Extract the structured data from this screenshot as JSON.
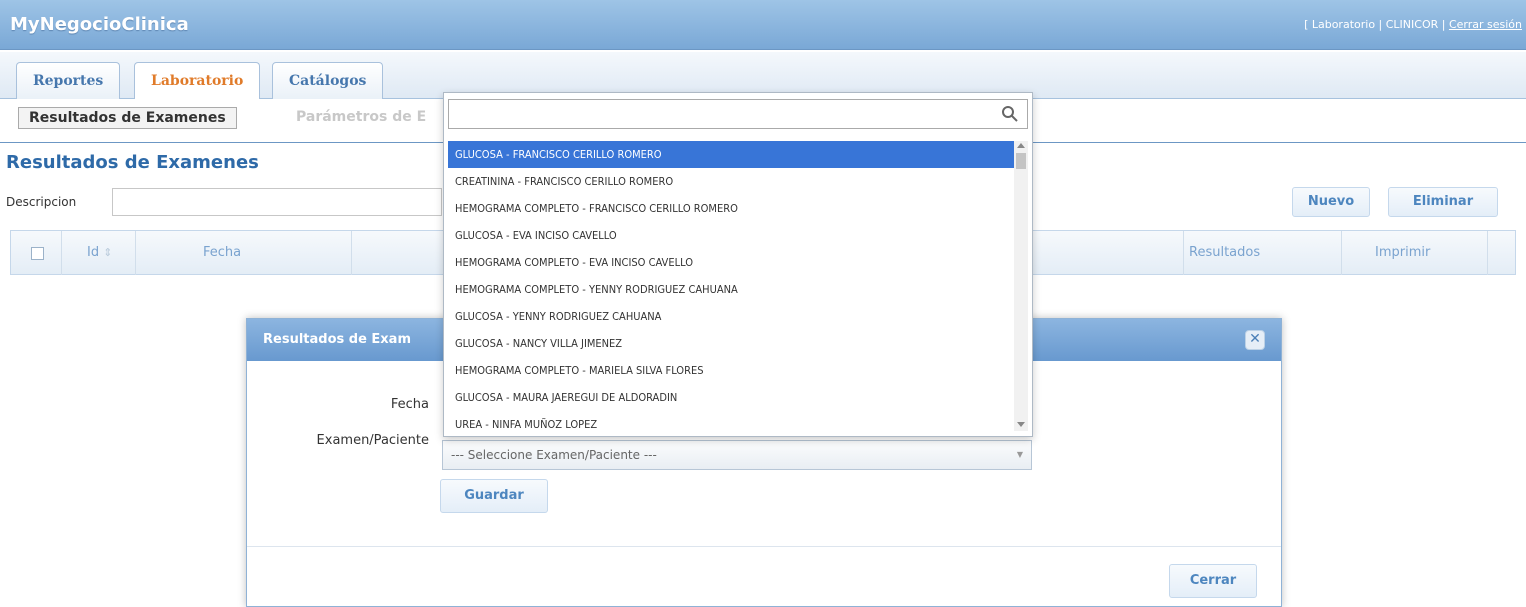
{
  "app": {
    "title": "MyNegocioClinica",
    "header_prefix": "[ Laboratorio | CLINICOR | ",
    "logout_link": "Cerrar sesión"
  },
  "tabs": [
    {
      "label": "Reportes"
    },
    {
      "label": "Laboratorio"
    },
    {
      "label": "Catálogos"
    }
  ],
  "subtabs": [
    {
      "label": "Resultados de Examenes"
    },
    {
      "label": "Parámetros de E"
    }
  ],
  "page": {
    "title": "Resultados de Examenes",
    "search_label": "Descripcion",
    "search_value": "",
    "new_button": "Nuevo",
    "delete_button": "Eliminar"
  },
  "grid": {
    "columns": [
      "Id",
      "Fecha",
      "Resultados",
      "Imprimir"
    ],
    "sort_glyph": "⇕"
  },
  "dialog": {
    "title": "Resultados de Exam",
    "close_glyph": "✕",
    "fecha_label": "Fecha",
    "exam_label": "Examen/Paciente",
    "select_placeholder": "--- Seleccione Examen/Paciente ---",
    "save_button": "Guardar",
    "close_button": "Cerrar"
  },
  "dropdown": {
    "search_value": "",
    "items": [
      "GLUCOSA - FRANCISCO CERILLO ROMERO",
      "CREATININA - FRANCISCO CERILLO ROMERO",
      "HEMOGRAMA COMPLETO - FRANCISCO CERILLO ROMERO",
      "GLUCOSA - EVA INCISO CAVELLO",
      "HEMOGRAMA COMPLETO - EVA INCISO CAVELLO",
      "HEMOGRAMA COMPLETO - YENNY RODRIGUEZ CAHUANA",
      "GLUCOSA - YENNY RODRIGUEZ CAHUANA",
      "GLUCOSA - NANCY VILLA JIMENEZ",
      "HEMOGRAMA COMPLETO - MARIELA SILVA FLORES",
      "GLUCOSA - MAURA JAEREGUI DE ALDORADIN",
      "UREA - NINFA MUÑOZ LOPEZ"
    ],
    "selected_index": 0
  },
  "colors": {
    "accent": "#3875d7",
    "header": "#7aa8d6",
    "active_tab": "#e07b2a",
    "link_blue": "#4677ad"
  }
}
